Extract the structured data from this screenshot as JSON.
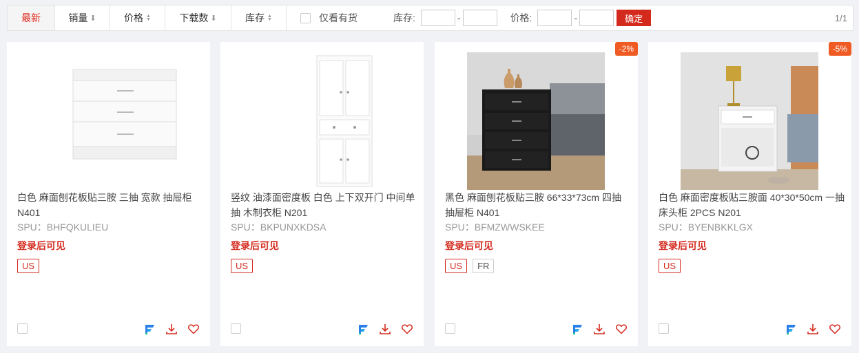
{
  "toolbar": {
    "sorts": [
      {
        "label": "最新",
        "arrow": ""
      },
      {
        "label": "销量",
        "arrow": "⬇"
      },
      {
        "label": "价格",
        "arrow": "updown"
      },
      {
        "label": "下载数",
        "arrow": "⬇"
      },
      {
        "label": "库存",
        "arrow": "updown"
      }
    ],
    "in_stock_label": "仅看有货",
    "stock_label": "库存:",
    "price_label": "价格:",
    "range_sep": "-",
    "confirm_label": "确定",
    "pager": "1/1"
  },
  "colors": {
    "accent": "#d42a1e",
    "discount": "#f05a23"
  },
  "products": [
    {
      "title": "白色 麻面刨花板贴三胺 三抽 宽款 抽屉柜 N401",
      "spu": "SPU：BHFQKULIEU",
      "price_note": "登录后可见",
      "tags": [
        "US"
      ],
      "discount": "",
      "image": "white-3-drawer-chest"
    },
    {
      "title": "竖纹 油漆面密度板 白色 上下双开门 中间单抽 木制衣柜 N201",
      "spu": "SPU：BKPUNXKDSA",
      "price_note": "登录后可见",
      "tags": [
        "US"
      ],
      "discount": "",
      "image": "white-tall-cabinet"
    },
    {
      "title": "黑色 麻面刨花板贴三胺 66*33*73cm 四抽 抽屉柜 N401",
      "spu": "SPU：BFMZWWSKEE",
      "price_note": "登录后可见",
      "tags": [
        "US",
        "FR"
      ],
      "discount": "-2%",
      "image": "black-4-drawer-chest"
    },
    {
      "title": "白色 麻面密度板贴三胺面 40*30*50cm 一抽 床头柜 2PCS N201",
      "spu": "SPU：BYENBKKLGX",
      "price_note": "登录后可见",
      "tags": [
        "US"
      ],
      "discount": "-5%",
      "image": "white-nightstand"
    }
  ]
}
